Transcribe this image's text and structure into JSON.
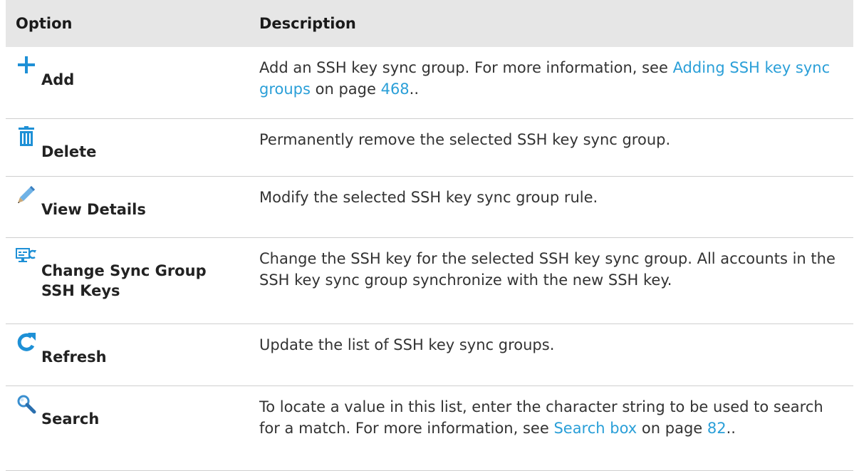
{
  "header": {
    "option": "Option",
    "description": "Description"
  },
  "rows": [
    {
      "option": "Add",
      "icon": "plus-icon",
      "desc_before": "Add an SSH key sync group. For more information, see ",
      "link_text": "Adding SSH key sync groups",
      "desc_middle": " on page ",
      "page": "468",
      "desc_after": ".."
    },
    {
      "option": "Delete",
      "icon": "trash-icon",
      "description": "Permanently remove the selected SSH key sync group."
    },
    {
      "option": "View Details",
      "icon": "pencil-icon",
      "description": "Modify the selected SSH key sync group rule."
    },
    {
      "option": "Change Sync Group SSH Keys",
      "icon": "change-key-icon",
      "description": "Change the SSH key for the selected SSH key sync group. All accounts in the SSH key sync group synchronize with the new SSH key."
    },
    {
      "option": "Refresh",
      "icon": "refresh-icon",
      "description": "Update the list of SSH key sync groups."
    },
    {
      "option": "Search",
      "icon": "search-icon",
      "desc_before": "To locate a value in this list, enter the character string to be used to search for a match. For more information, see ",
      "link_text": "Search box",
      "desc_middle": " on page ",
      "page": "82",
      "desc_after": ".."
    }
  ],
  "colors": {
    "header_bg": "#e6e6e6",
    "link": "#2a9fd8",
    "icon": "#1e90d6"
  }
}
